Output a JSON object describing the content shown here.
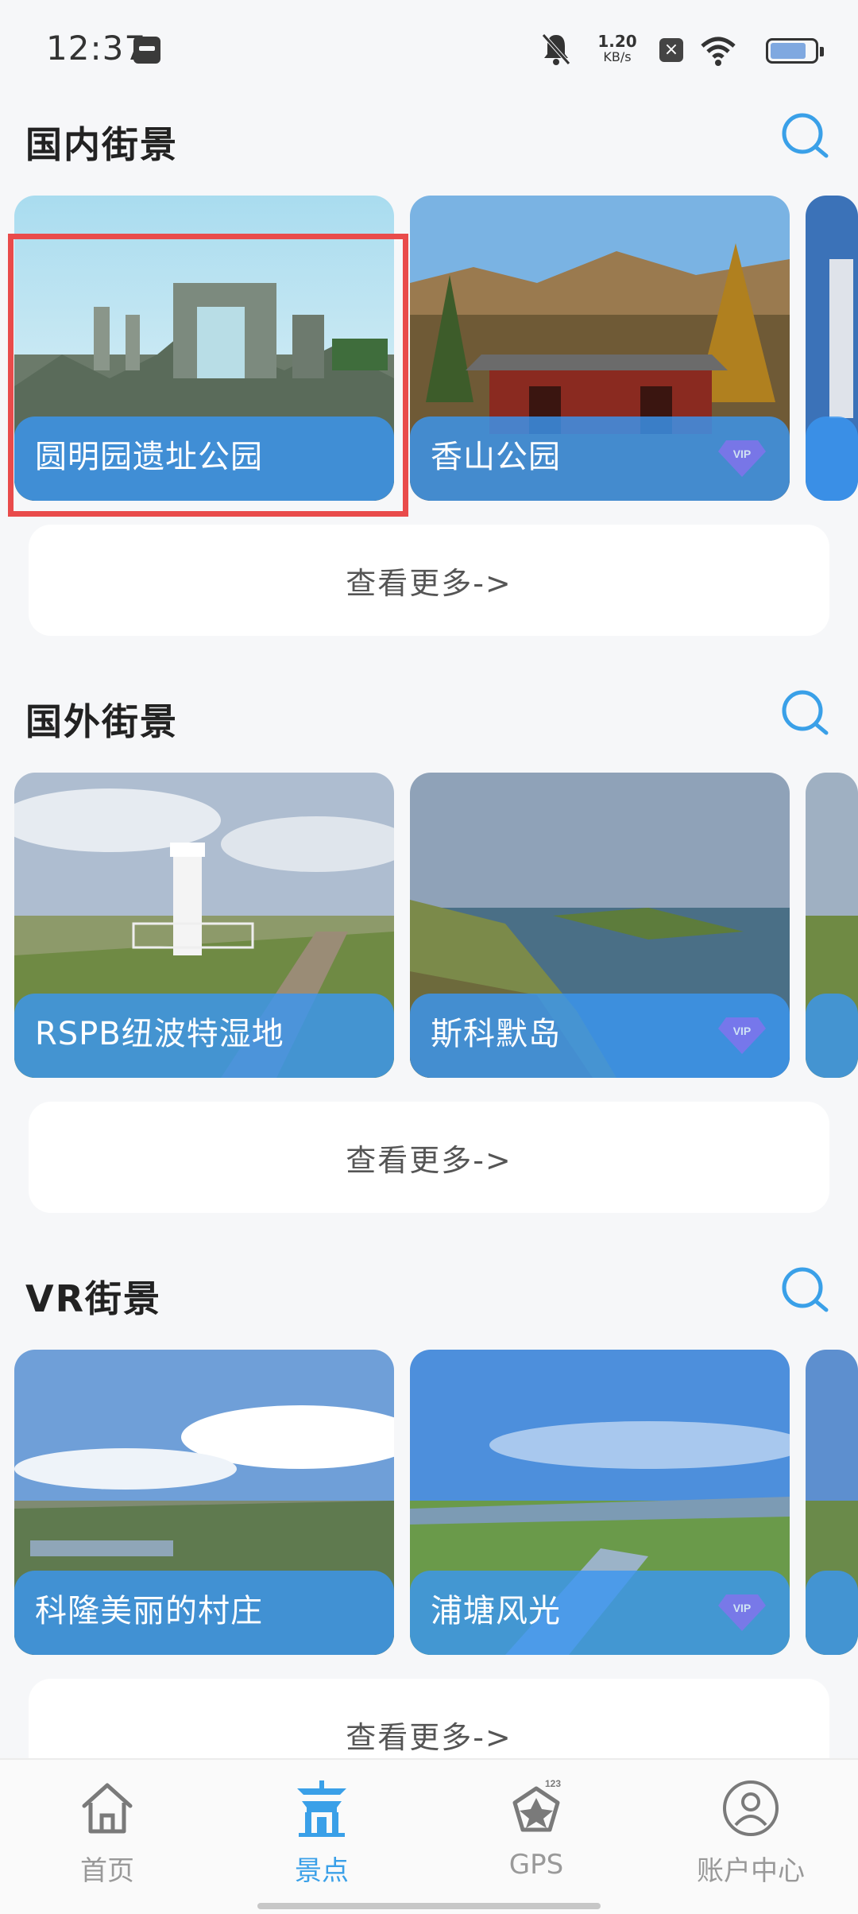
{
  "status_bar": {
    "time": "12:37",
    "speed_value": "1.20",
    "speed_unit": "KB/s"
  },
  "sections": [
    {
      "title": "国内街景",
      "cards": [
        {
          "label": "圆明园遗址公园",
          "vip": false
        },
        {
          "label": "香山公园",
          "vip": true
        },
        {
          "label": "",
          "vip": false
        }
      ],
      "more_label": "查看更多->"
    },
    {
      "title": "国外街景",
      "cards": [
        {
          "label": "RSPB纽波特湿地",
          "vip": false
        },
        {
          "label": "斯科默岛",
          "vip": true
        },
        {
          "label": "",
          "vip": false
        }
      ],
      "more_label": "查看更多->"
    },
    {
      "title": "VR街景",
      "cards": [
        {
          "label": "科隆美丽的村庄",
          "vip": false
        },
        {
          "label": "浦塘风光",
          "vip": true
        },
        {
          "label": "",
          "vip": false
        }
      ],
      "more_label": "查看更多->"
    }
  ],
  "bottom_nav": [
    {
      "label": "首页",
      "icon": "home-icon",
      "active": false
    },
    {
      "label": "景点",
      "icon": "pavilion-icon",
      "active": true
    },
    {
      "label": "GPS",
      "icon": "gps-badge-icon",
      "active": false
    },
    {
      "label": "账户中心",
      "icon": "account-icon",
      "active": false
    }
  ],
  "colors": {
    "accent": "#3aa0e8",
    "card_band": "#3a96f0",
    "highlight": "#e94b4b",
    "background": "#f6f7f9"
  }
}
